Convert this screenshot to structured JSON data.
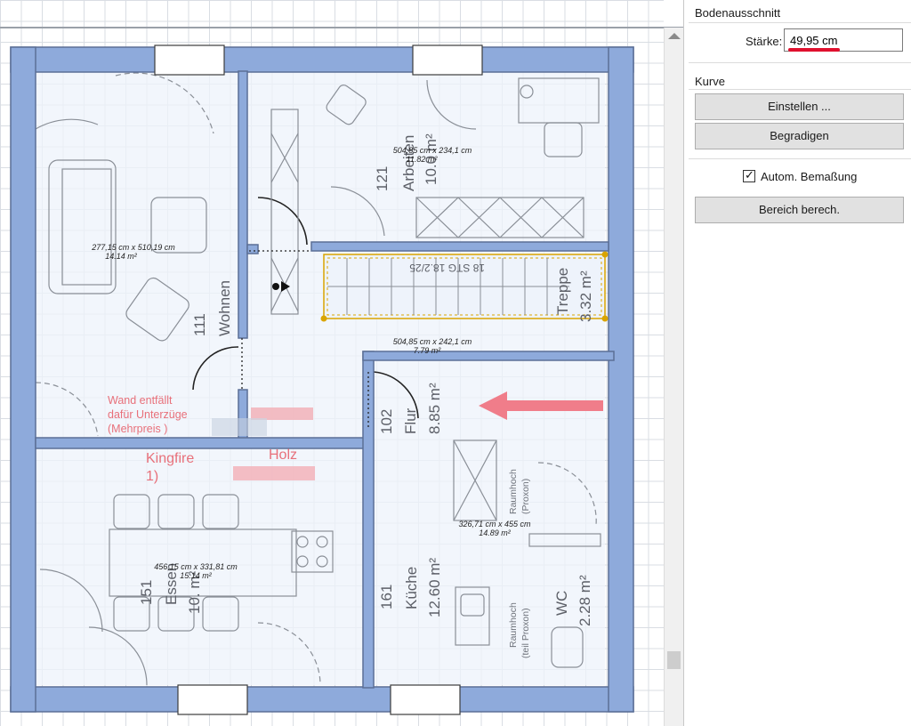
{
  "panel": {
    "section_floor": "Bodenausschnitt",
    "thickness_label": "Stärke:",
    "thickness_value": "49,95 cm",
    "section_curve": "Kurve",
    "btn_adjust": "Einstellen ...",
    "btn_straighten": "Begradigen",
    "auto_dim_label": "Autom. Bemaßung",
    "auto_dim_checked": true,
    "btn_calc_area": "Bereich berech."
  },
  "rooms": [
    {
      "id": "wohnen",
      "dims": "277,15 cm x 510,19 cm",
      "area": "14.14 m²",
      "name": "Wohnen",
      "number": "111"
    },
    {
      "id": "arbeiten",
      "dims": "504,85 cm x 234,1 cm",
      "area": "11.82 m²",
      "name": "Arbeiten",
      "number": "121",
      "room_area": "10.0 m²"
    },
    {
      "id": "flur",
      "dims": "504,85 cm x 242,1 cm",
      "area": "7.79 m²",
      "name": "Flur",
      "number": "102",
      "room_area": "8.85 m²"
    },
    {
      "id": "kueche",
      "dims": "326,71 cm x 455 cm",
      "area": "14.89 m²",
      "name": "Küche",
      "number": "161",
      "room_area": "12.60 m²"
    },
    {
      "id": "essen",
      "dims": "456,15 cm x 331,81 cm",
      "area": "15.14 m²",
      "name": "Essen",
      "number": "151",
      "room_area": "10. m²"
    },
    {
      "id": "wc",
      "name": "WC",
      "room_area": "2.28 m²"
    }
  ],
  "stair": {
    "label": "18 STG 18.2/25",
    "name": "Treppe",
    "area": "3.32 m²"
  },
  "annotations": {
    "note_lines": [
      "Wand entfällt",
      "dafür Unterzüge",
      "(Mehrpreis )"
    ],
    "kingfire": [
      "Kingfire",
      "1)"
    ],
    "holz": "Holz",
    "raumhoch_1": [
      "Raumhoch",
      "(Proxon)"
    ],
    "raumhoch_2": [
      "Raumhoch",
      "(teil Proxon)"
    ]
  },
  "colors": {
    "wall": "#8eaadb",
    "wall_stroke": "#5b6f96",
    "annotation_red": "#e8707a",
    "arrow": "#f07d8a",
    "selection": "#d9a400"
  }
}
